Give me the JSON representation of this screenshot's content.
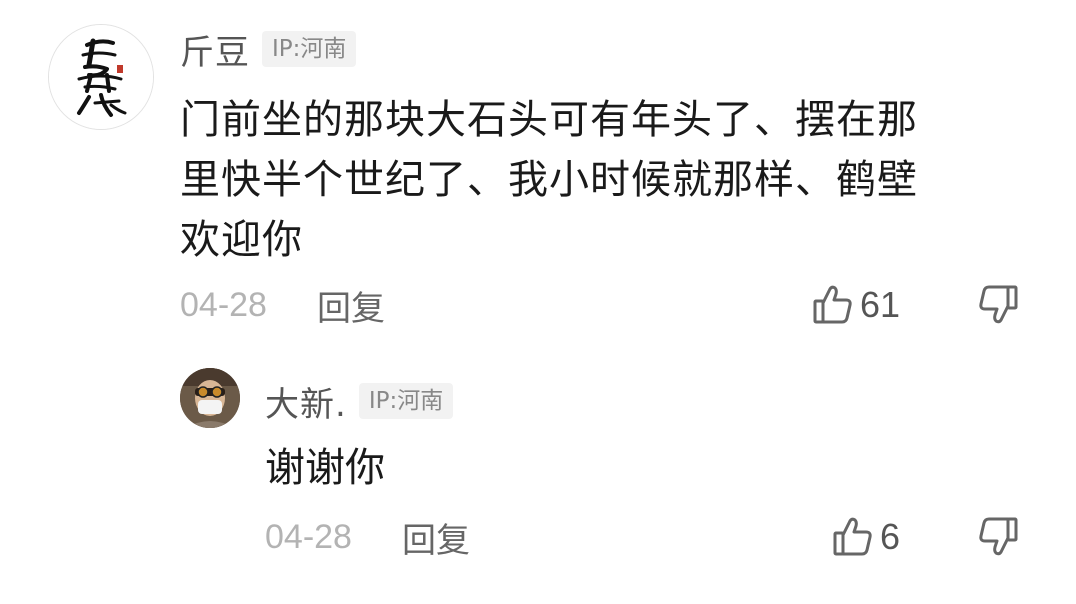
{
  "main_comment": {
    "author": "斤豆",
    "ip": "IP:河南",
    "avatar_text": "君莫笑",
    "text_lines": [
      "门前坐的那块大石头可有年头了、摆在那",
      "里快半个世纪了、我小时候就那样、鹤壁",
      "欢迎你"
    ],
    "date": "04-28",
    "reply_label": "回复",
    "likes": "61"
  },
  "reply_comment": {
    "author": "大新.",
    "ip": "IP:河南",
    "text": "谢谢你",
    "date": "04-28",
    "reply_label": "回复",
    "likes": "6"
  },
  "icons": {
    "like": "thumbs-up-icon",
    "dislike": "thumbs-down-icon"
  },
  "colors": {
    "text_primary": "#1a1a1a",
    "text_secondary": "#555555",
    "text_muted": "#b3b3b3",
    "ip_tag_bg": "#f2f2f2"
  }
}
